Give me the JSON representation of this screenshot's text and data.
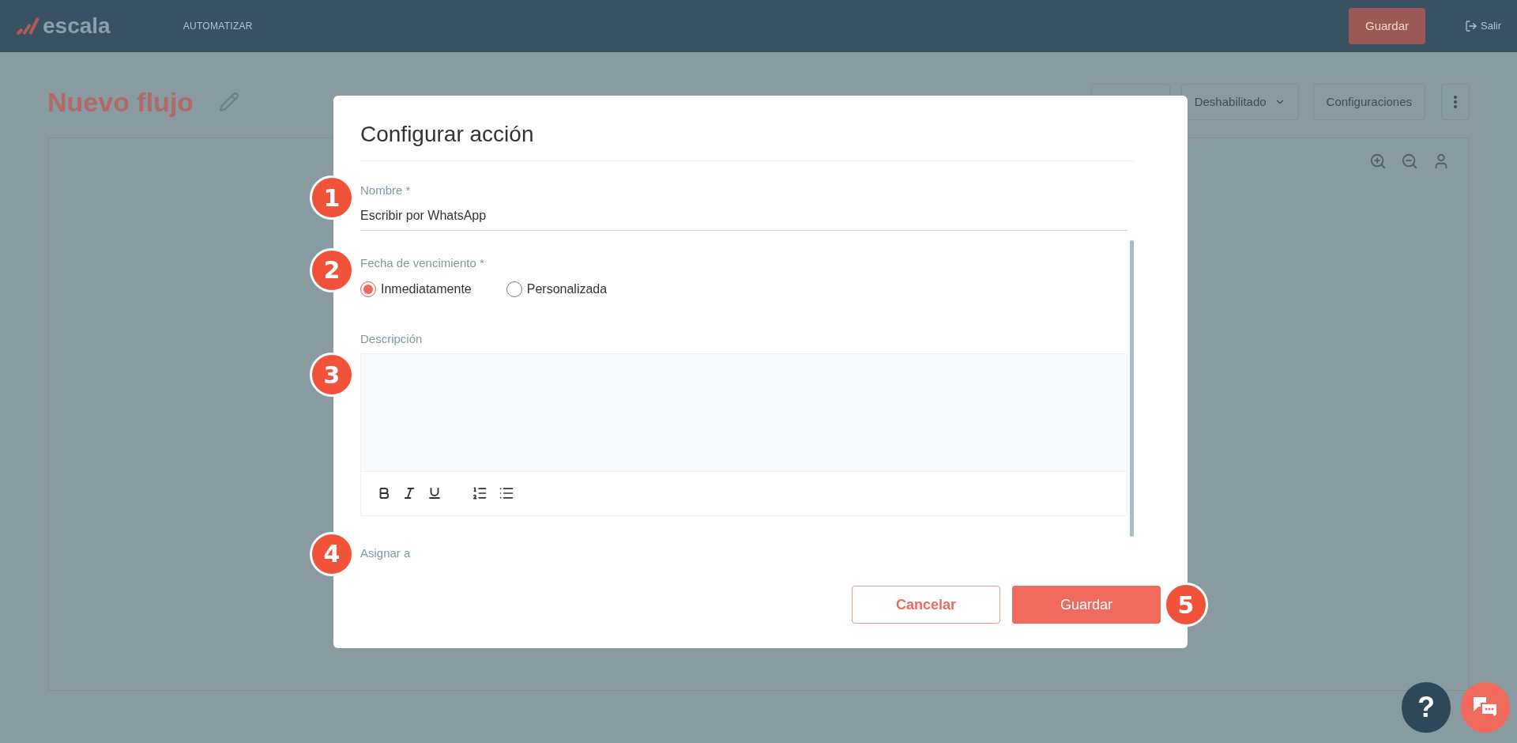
{
  "header": {
    "logo": "escala",
    "nav": [
      "AUTOMATIZAR"
    ],
    "save_button": "Guardar",
    "logout": "Salir"
  },
  "page": {
    "title": "Nuevo flujo",
    "status_dropdown": "Deshabilitado",
    "settings_button": "Configuraciones"
  },
  "dialog": {
    "title": "Configurar acción",
    "fields": [
      {
        "kind": "text",
        "label": "Nombre *",
        "value": "Escribir por WhatsApp",
        "marker": "1"
      },
      {
        "kind": "radio",
        "label": "Fecha de vencimiento *",
        "marker": "2",
        "options": [
          {
            "label": "Inmediatamente",
            "selected": true
          },
          {
            "label": "Personalizada",
            "selected": false
          }
        ]
      },
      {
        "kind": "richtext",
        "label": "Descripción",
        "marker": "3"
      },
      {
        "kind": "assign",
        "label": "Asignar a",
        "marker": "4"
      }
    ],
    "buttons": [
      {
        "kind": "secondary",
        "label": "Cancelar"
      },
      {
        "kind": "primary",
        "label": "Guardar",
        "marker": "5"
      }
    ]
  },
  "help_button": "?"
}
